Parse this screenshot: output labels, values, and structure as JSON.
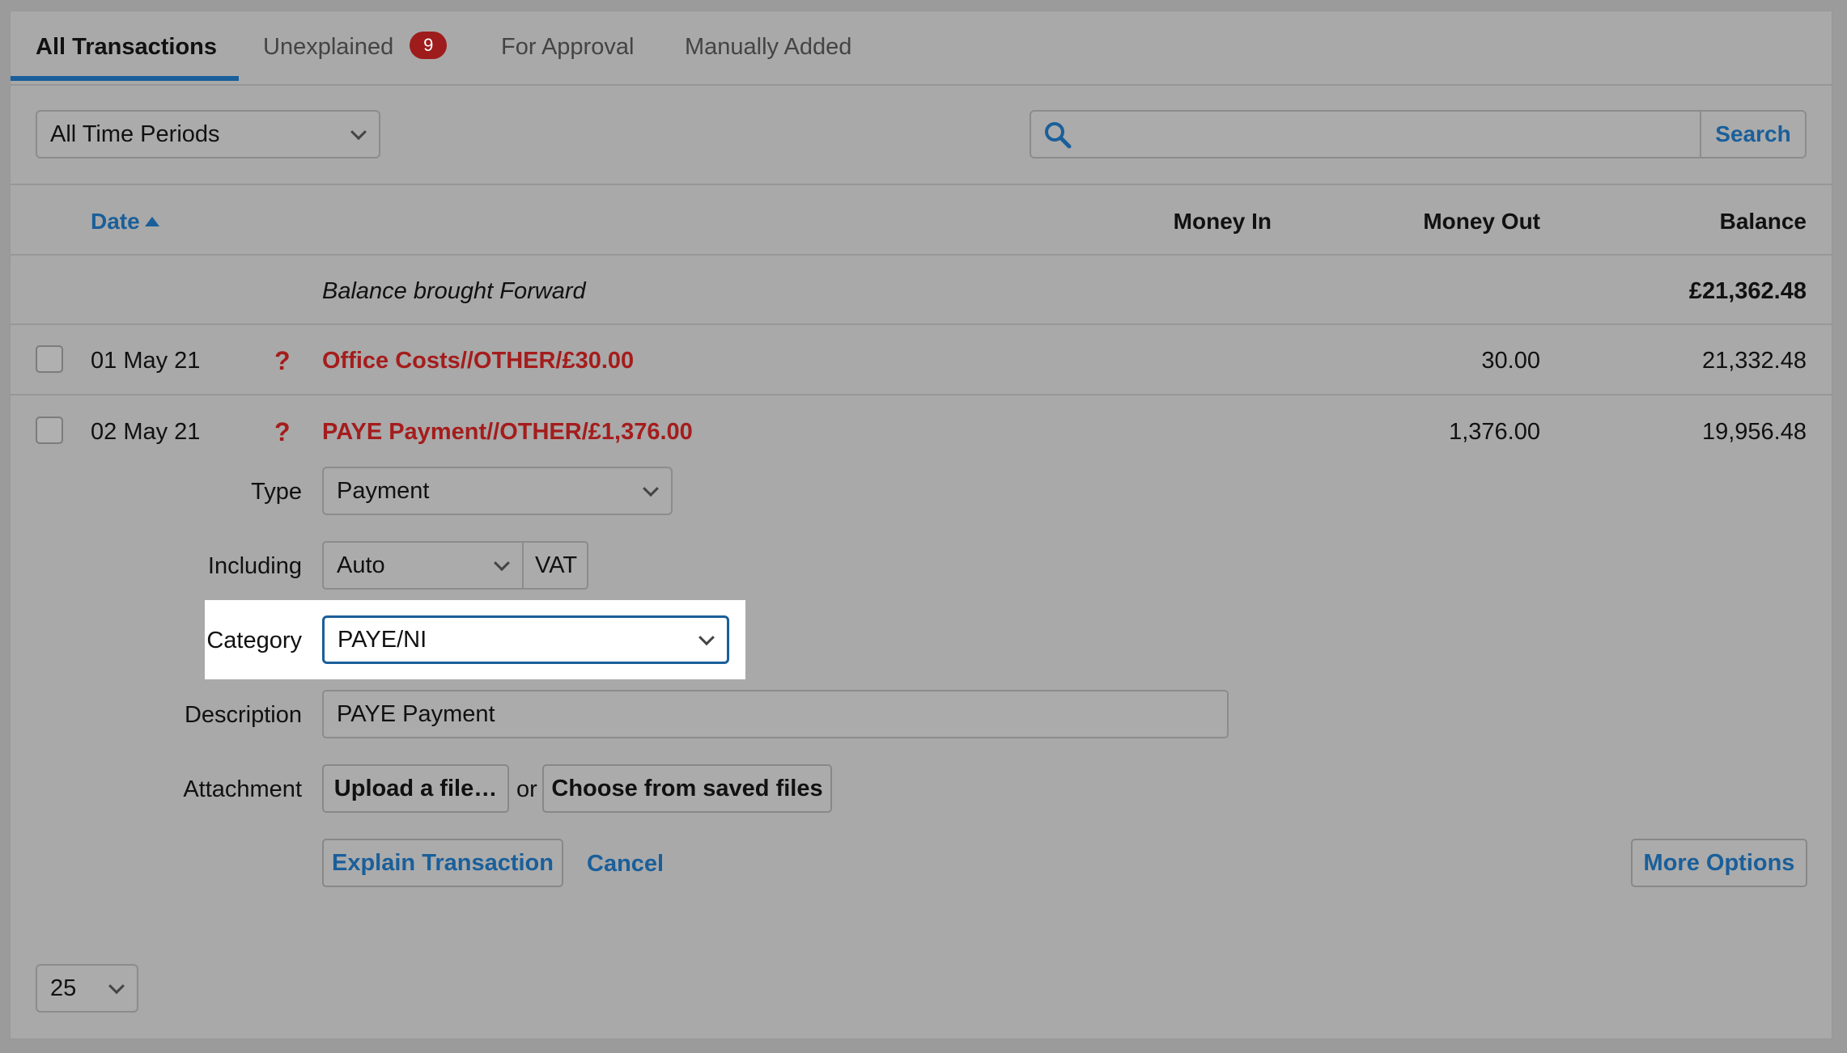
{
  "tabs": [
    {
      "label": "All Transactions",
      "active": true
    },
    {
      "label": "Unexplained",
      "badge": "9"
    },
    {
      "label": "For Approval"
    },
    {
      "label": "Manually Added"
    }
  ],
  "filter": {
    "period": "All Time Periods",
    "search_placeholder": "",
    "search_button": "Search"
  },
  "columns": {
    "date": "Date",
    "money_in": "Money In",
    "money_out": "Money Out",
    "balance": "Balance"
  },
  "brought_forward": {
    "label": "Balance brought Forward",
    "balance": "£21,362.48"
  },
  "rows": [
    {
      "date": "01 May 21",
      "flag": "?",
      "description": "Office Costs//OTHER/£30.00",
      "money_out": "30.00",
      "balance": "21,332.48"
    },
    {
      "date": "02 May 21",
      "flag": "?",
      "description": "PAYE Payment//OTHER/£1,376.00",
      "money_out": "1,376.00",
      "balance": "19,956.48"
    }
  ],
  "form": {
    "type_label": "Type",
    "type_value": "Payment",
    "including_label": "Including",
    "including_value": "Auto",
    "vat_label": "VAT",
    "category_label": "Category",
    "category_value": "PAYE/NI",
    "description_label": "Description",
    "description_value": "PAYE Payment",
    "attachment_label": "Attachment",
    "upload_label": "Upload a file…",
    "or_text": "or",
    "choose_label": "Choose from saved files",
    "explain_label": "Explain Transaction",
    "cancel_label": "Cancel",
    "more_options_label": "More Options"
  },
  "pagination": {
    "per_page": "25"
  },
  "colors": {
    "accent": "#1a5f9a",
    "alert": "#a51c1c",
    "badge": "#9e1c1c"
  }
}
